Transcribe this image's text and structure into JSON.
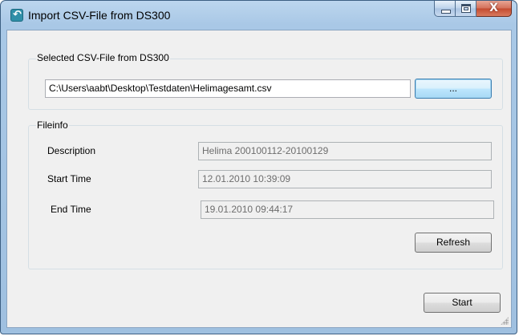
{
  "window": {
    "title": "Import CSV-File from DS300",
    "icon": "app-logo-icon",
    "controls": {
      "minimize_icon": "minimize-icon",
      "maximize_icon": "maximize-icon",
      "close_glyph": "X"
    }
  },
  "file_group": {
    "label": "Selected CSV-File from DS300",
    "path_value": "C:\\Users\\aabt\\Desktop\\Testdaten\\Helimagesamt.csv",
    "browse_label": "..."
  },
  "fileinfo_group": {
    "label": "Fileinfo",
    "description_label": "Description",
    "description_value": "Helima 200100112-20100129",
    "start_label": "Start Time",
    "start_value": "12.01.2010 10:39:09",
    "end_label": "End Time",
    "end_value": "19.01.2010 09:44:17",
    "refresh_label": "Refresh"
  },
  "footer": {
    "start_label": "Start"
  },
  "colors": {
    "title_gradient_top": "#bcd6ee",
    "close_button": "#c44a2f",
    "client_bg": "#f0f0f0",
    "focus_border": "#3c7fb1"
  }
}
